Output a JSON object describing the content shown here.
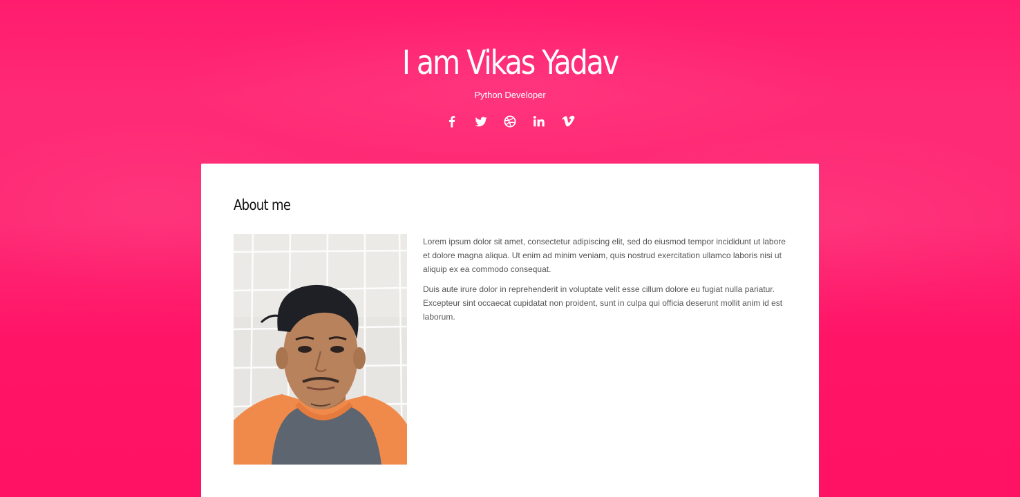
{
  "hero": {
    "title": "I am Vikas Yadav",
    "subtitle": "Python Developer"
  },
  "social": [
    {
      "icon": "facebook-icon"
    },
    {
      "icon": "twitter-icon"
    },
    {
      "icon": "dribbble-icon"
    },
    {
      "icon": "linkedin-icon"
    },
    {
      "icon": "vimeo-icon"
    }
  ],
  "about": {
    "title": "About me",
    "paragraphs": [
      "Lorem ipsum dolor sit amet, consectetur adipiscing elit, sed do eiusmod tempor incididunt ut labore et dolore magna aliqua. Ut enim ad minim veniam, quis nostrud exercitation ullamco laboris nisi ut aliquip ex ea commodo consequat.",
      "Duis aute irure dolor in reprehenderit in voluptate velit esse cillum dolore eu fugiat nulla pariatur. Excepteur sint occaecat cupidatat non proident, sunt in culpa qui officia deserunt mollit anim id est laborum."
    ]
  },
  "colors": {
    "background": "#ff1c6e",
    "card": "#ffffff",
    "heading": "#111111",
    "body_text": "#555555"
  }
}
